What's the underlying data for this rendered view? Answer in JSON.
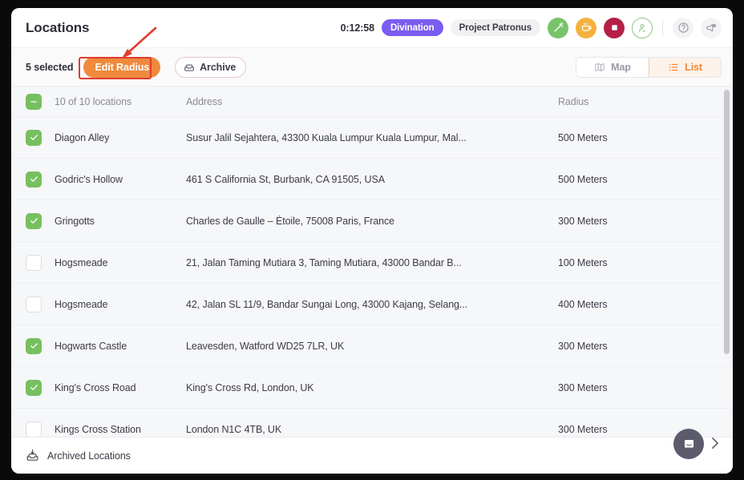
{
  "header": {
    "title": "Locations",
    "timer": "0:12:58",
    "task_badge": "Divination",
    "project_badge": "Project Patronus",
    "accent_color": "#ef8a3c",
    "task_badge_color": "#7b5cf0",
    "buttons": {
      "magic": "magic-wand-icon",
      "break": "coffee-cup-icon",
      "stop": "stop-icon",
      "profile": "user-avatar-icon",
      "help": "help-circle-icon",
      "announcement": "announcement-icon"
    }
  },
  "toolbar": {
    "selected_label": "5 selected",
    "edit_radius_label": "Edit Radius",
    "archive_label": "Archive",
    "view_map_label": "Map",
    "view_list_label": "List",
    "active_view": "List"
  },
  "table": {
    "columns": {
      "select_all_label": "10 of 10 locations",
      "address": "Address",
      "radius": "Radius"
    },
    "select_all_state": "indeterminate",
    "rows": [
      {
        "checked": true,
        "name": "Diagon Alley",
        "address": "Susur Jalil Sejahtera, 43300 Kuala Lumpur Kuala Lumpur, Mal...",
        "radius": "500 Meters"
      },
      {
        "checked": true,
        "name": "Godric's Hollow",
        "address": "461 S California St, Burbank, CA 91505, USA",
        "radius": "500 Meters"
      },
      {
        "checked": true,
        "name": "Gringotts",
        "address": "Charles de Gaulle – Étoile, 75008 Paris, France",
        "radius": "300 Meters"
      },
      {
        "checked": false,
        "name": "Hogsmeade",
        "address": "21, Jalan Taming Mutiara 3, Taming Mutiara, 43000 Bandar B...",
        "radius": "100 Meters"
      },
      {
        "checked": false,
        "name": "Hogsmeade",
        "address": "42, Jalan SL 11/9, Bandar Sungai Long, 43000 Kajang, Selang...",
        "radius": "400 Meters"
      },
      {
        "checked": true,
        "name": "Hogwarts Castle",
        "address": "Leavesden, Watford WD25 7LR, UK",
        "radius": "300 Meters"
      },
      {
        "checked": true,
        "name": "King's Cross Road",
        "address": "King's Cross Rd, London, UK",
        "radius": "300 Meters"
      },
      {
        "checked": false,
        "name": "Kings Cross Station",
        "address": "London N1C 4TB, UK",
        "radius": "300 Meters"
      }
    ]
  },
  "footer": {
    "archived_label": "Archived Locations"
  },
  "annotation": {
    "color": "#e03c31",
    "target": "Edit Radius"
  }
}
